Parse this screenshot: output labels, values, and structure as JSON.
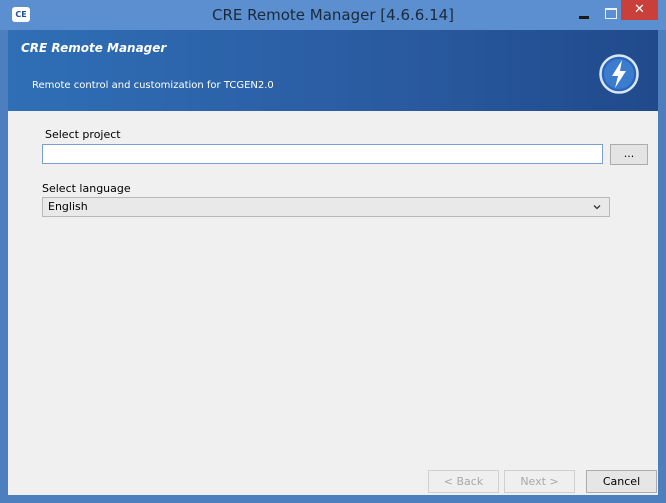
{
  "window": {
    "title": "CRE Remote Manager [4.6.6.14]",
    "app_icon_text": "CE",
    "close_glyph": "✕"
  },
  "banner": {
    "title": "CRE Remote Manager",
    "subtitle": "Remote control and customization for TCGEN2.0",
    "logo_icon": "lightning-bolt-icon"
  },
  "form": {
    "project_label": "Select project",
    "project_value": "",
    "browse_label": "...",
    "language_label": "Select language",
    "language_value": "English"
  },
  "footer": {
    "back_label": "< Back",
    "next_label": "Next >",
    "cancel_label": "Cancel"
  },
  "colors": {
    "accent": "#2f6fb6",
    "title_bar": "#5b8fd0",
    "close_button": "#c9403a"
  }
}
